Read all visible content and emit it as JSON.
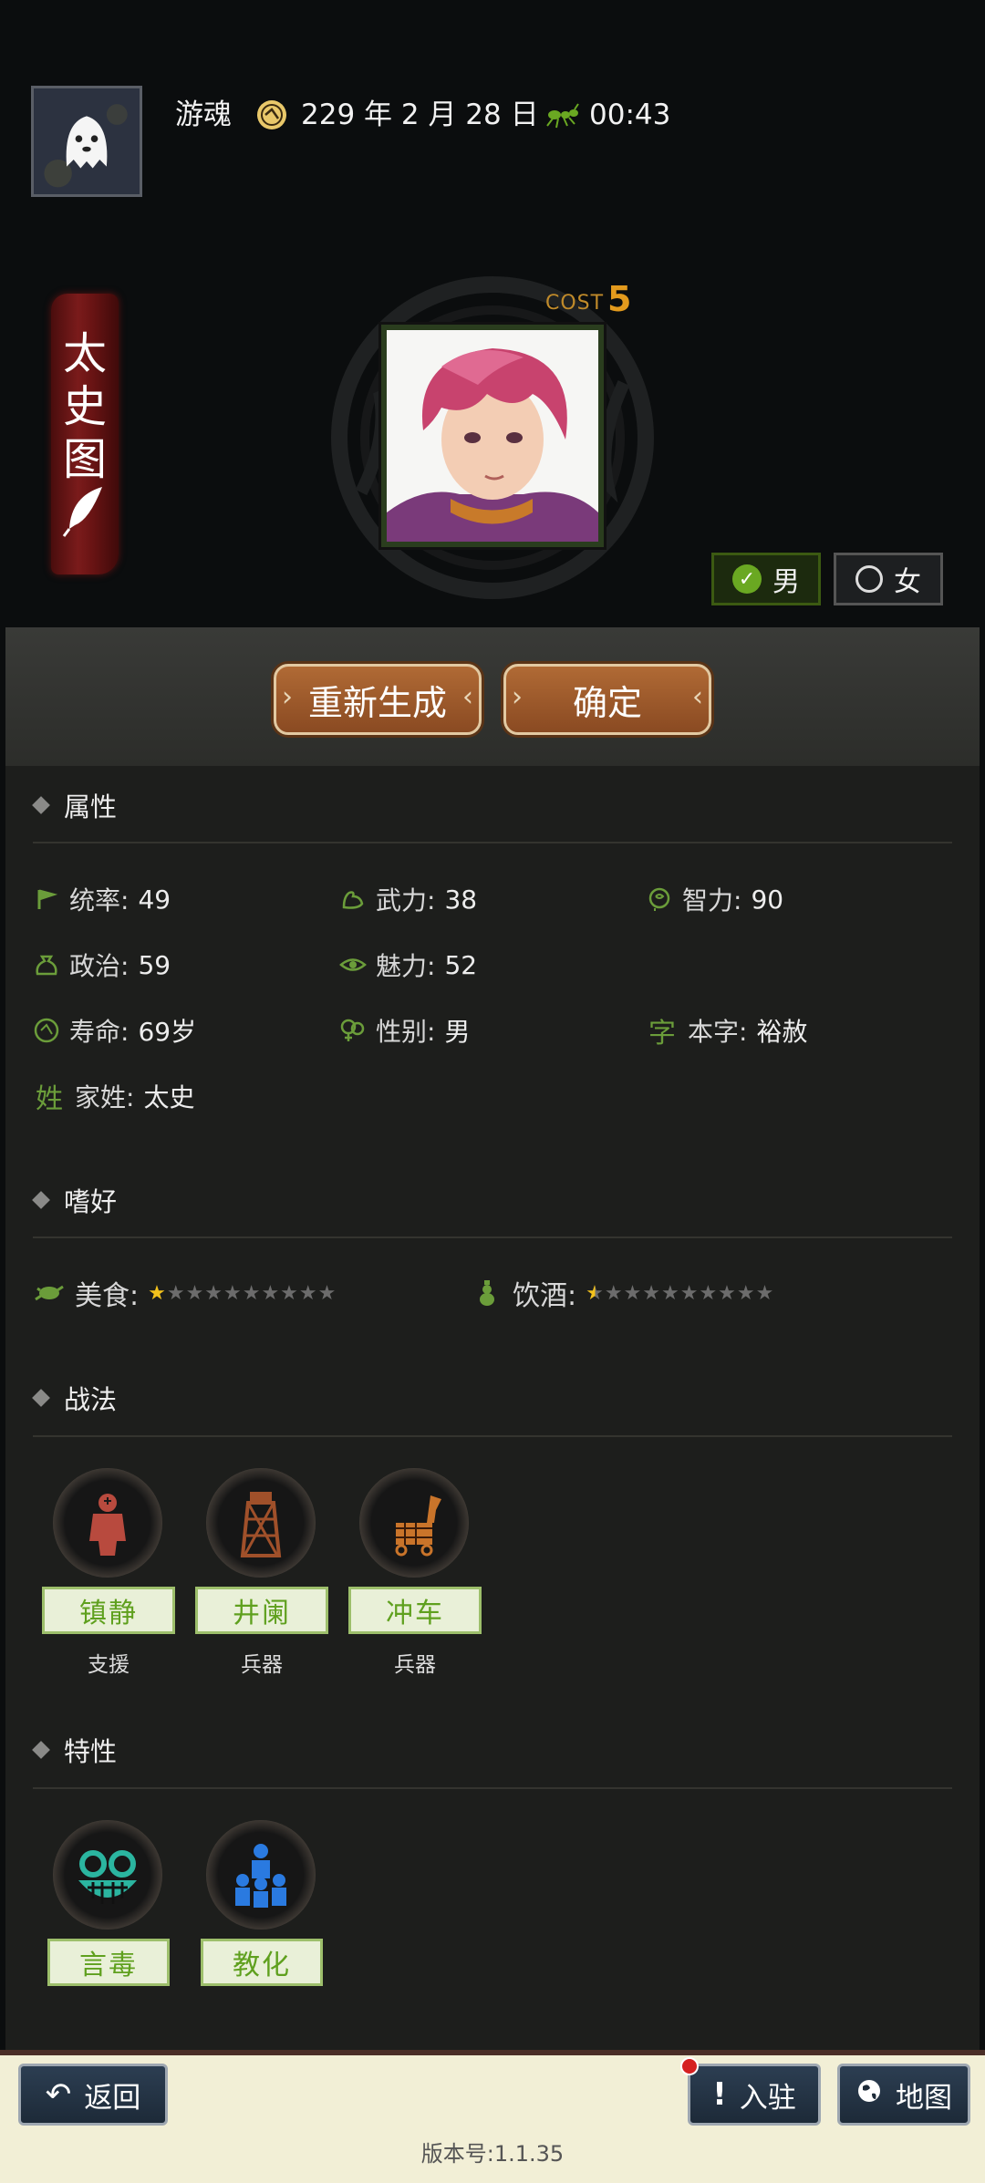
{
  "header": {
    "player_name": "游魂",
    "date": "229 年 2 月 28 日",
    "time": "00:43",
    "icons": [
      "ghost-avatar-icon",
      "calendar-dial-icon",
      "ant-clock-icon"
    ]
  },
  "side_banner": {
    "chars": [
      "太",
      "史",
      "图"
    ],
    "icon": "feather-quill-icon"
  },
  "portrait": {
    "cost_label": "COST",
    "cost_value": "5"
  },
  "gender": {
    "male_label": "男",
    "female_label": "女",
    "selected": "male"
  },
  "actions": {
    "regenerate_label": "重新生成",
    "confirm_label": "确定"
  },
  "sections": {
    "attributes_title": "属性",
    "hobbies_title": "嗜好",
    "tactics_title": "战法",
    "traits_title": "特性"
  },
  "attributes": [
    {
      "label": "统率:",
      "value": "49",
      "icon": "flag-icon"
    },
    {
      "label": "武力:",
      "value": "38",
      "icon": "muscle-arm-icon"
    },
    {
      "label": "智力:",
      "value": "90",
      "icon": "brain-head-icon"
    },
    {
      "label": "政治:",
      "value": "59",
      "icon": "pouch-icon"
    },
    {
      "label": "魅力:",
      "value": "52",
      "icon": "eye-icon"
    },
    {
      "label": "寿命:",
      "value": "69岁",
      "icon": "calendar-dial-icon"
    },
    {
      "label": "性别:",
      "value": "男",
      "icon": "gender-icon"
    },
    {
      "label": "本字:",
      "value": "裕赦",
      "icon": "zi-character-icon",
      "glyph": "字"
    },
    {
      "label": "家姓:",
      "value": "太史",
      "icon": "xing-character-icon",
      "glyph": "姓"
    }
  ],
  "hobbies": [
    {
      "label": "美食:",
      "rating": 1,
      "max": 10,
      "icon": "food-icon"
    },
    {
      "label": "饮酒:",
      "rating": 0.5,
      "max": 10,
      "icon": "wine-gourd-icon"
    }
  ],
  "tactics": [
    {
      "name": "镇静",
      "type": "支援",
      "icon": "calm-soldier-icon"
    },
    {
      "name": "井阑",
      "type": "兵器",
      "icon": "siege-tower-icon"
    },
    {
      "name": "冲车",
      "type": "兵器",
      "icon": "battering-horse-icon"
    }
  ],
  "traits": [
    {
      "name": "言毒",
      "icon": "grinning-mask-icon"
    },
    {
      "name": "教化",
      "icon": "teaching-people-icon"
    }
  ],
  "bottom": {
    "back_label": "返回",
    "station_label": "入驻",
    "map_label": "地图",
    "version": "版本号:1.1.35"
  },
  "colors": {
    "background": "#0b0d0e",
    "panel": "#1d1e1c",
    "accent_green": "#6b9d3a",
    "button_brown": "#9a5a2c",
    "bottom_bar": "#f2efd6"
  }
}
